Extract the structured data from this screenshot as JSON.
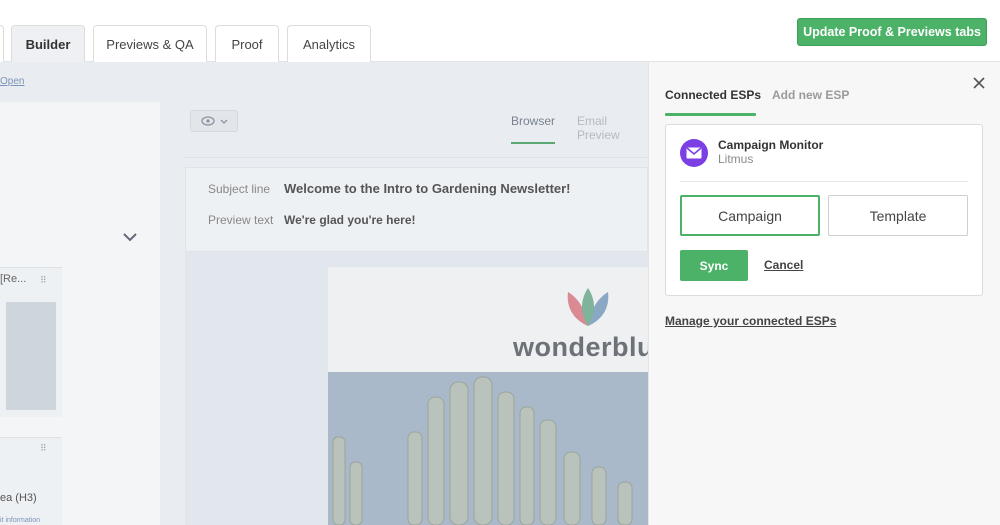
{
  "tabs": [
    {
      "label": "Builder",
      "active": true
    },
    {
      "label": "Previews & QA",
      "active": false
    },
    {
      "label": "Proof",
      "active": false
    },
    {
      "label": "Analytics",
      "active": false
    }
  ],
  "update_button": "Update Proof & Previews tabs",
  "editor": {
    "link_fragment": "Open",
    "view_tabs": [
      "Browser",
      "Email Preview"
    ],
    "subject_label": "Subject line",
    "subject_value": "Welcome to the Intro to Gardening Newsletter!",
    "preview_label": "Preview text",
    "preview_value": "We're glad you're here!",
    "left_card_text": "[Re...",
    "h3_fragment": "ea (H3)",
    "info_fragment": "it information",
    "logo_text": "wonderblum"
  },
  "esp_panel": {
    "tabs": [
      "Connected ESPs",
      "Add new ESP"
    ],
    "esp_name": "Campaign Monitor",
    "esp_sub": "Litmus",
    "option_campaign": "Campaign",
    "option_template": "Template",
    "selected_option": "Campaign",
    "sync_label": "Sync",
    "cancel_label": "Cancel",
    "manage_label": "Manage your connected ESPs"
  },
  "colors": {
    "accent": "#4bb267",
    "esp_brand": "#7b3fe4",
    "overlay": "#e9edf1"
  }
}
